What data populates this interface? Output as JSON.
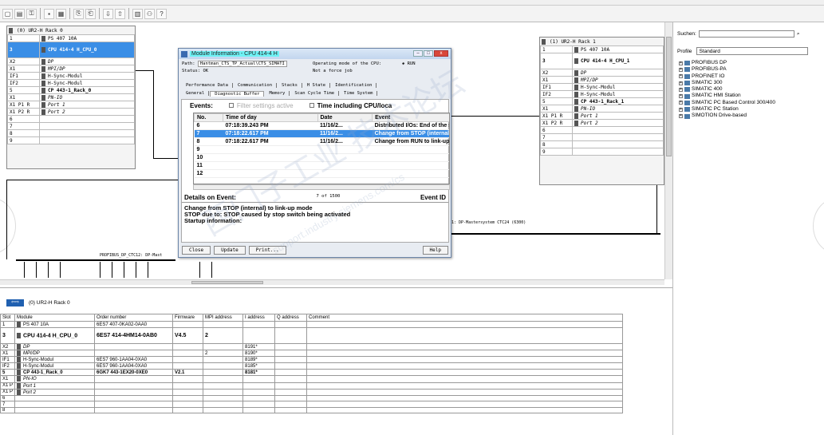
{
  "toolbar": {
    "icons": [
      "new-icon",
      "open-icon",
      "network-icon",
      "save-icon",
      "print-icon",
      "copy-icon",
      "paste-icon",
      "download-icon",
      "upload-icon",
      "catalog-icon",
      "net-icon",
      "help-icon"
    ]
  },
  "rack0": {
    "title": "(0) UR2-H Rack 0",
    "rows": [
      {
        "slot": "1",
        "module": "PS 407 10A",
        "big": false
      },
      {
        "slot": "3",
        "module": "CPU 414-4 H_CPU_0",
        "big": true,
        "selected": true
      },
      {
        "slot": "X2",
        "module": "DP",
        "italic": true
      },
      {
        "slot": "X1",
        "module": "MPI/DP",
        "italic": true
      },
      {
        "slot": "IF1",
        "module": "H-Sync-Modul"
      },
      {
        "slot": "IF2",
        "module": "H-Sync-Modul"
      },
      {
        "slot": "5",
        "module": "CP 443-1_Rack_0",
        "bold": true
      },
      {
        "slot": "X1",
        "module": "PN-IO",
        "italic": true
      },
      {
        "slot": "X1 P1 R",
        "module": "Port 1",
        "italic": true
      },
      {
        "slot": "X1 P2 R",
        "module": "Port 2",
        "italic": true
      },
      {
        "slot": "6",
        "module": ""
      },
      {
        "slot": "7",
        "module": ""
      },
      {
        "slot": "8",
        "module": ""
      },
      {
        "slot": "9",
        "module": ""
      }
    ]
  },
  "rack1": {
    "title": "(1) UR2-H Rack 1",
    "rows": [
      {
        "slot": "1",
        "module": "PS 407 10A",
        "big": false
      },
      {
        "slot": "3",
        "module": "CPU 414-4 H_CPU_1",
        "big": true
      },
      {
        "slot": "X2",
        "module": "DP",
        "italic": true
      },
      {
        "slot": "X1",
        "module": "MPI/DP",
        "italic": true
      },
      {
        "slot": "IF1",
        "module": "H-Sync-Modul"
      },
      {
        "slot": "IF2",
        "module": "H-Sync-Modul"
      },
      {
        "slot": "5",
        "module": "CP 443-1_Rack_1",
        "bold": true
      },
      {
        "slot": "X1",
        "module": "PN-IO",
        "italic": true
      },
      {
        "slot": "X1 P1 R",
        "module": "Port 1",
        "italic": true
      },
      {
        "slot": "X1 P2 R",
        "module": "Port 2",
        "italic": true
      },
      {
        "slot": "6",
        "module": ""
      },
      {
        "slot": "7",
        "module": ""
      },
      {
        "slot": "8",
        "module": ""
      },
      {
        "slot": "9",
        "module": ""
      }
    ]
  },
  "bus": {
    "profibus_label": "PROFIBUS_DP_CTC12: DP-Mast",
    "dp_label": "1: DP-Mastersystem CTC24 (6300)"
  },
  "dialog": {
    "title": "Module Information - CPU 414-4 H",
    "path_label": "Path:",
    "path_value": "Hantman_CTS_TP_Actual\\CTS_SIMATI",
    "mode_label": "Operating mode of the CPU:",
    "mode_value": "RUN",
    "status_label": "Status: OK",
    "force_text": "Not a force job",
    "tabs_row1": [
      "Performance Data",
      "Communication",
      "Stacks",
      "H State",
      "Identification"
    ],
    "tabs_row2": [
      "General",
      "Diagnostic Buffer",
      "Memory",
      "Scan Cycle Time",
      "Time System"
    ],
    "active_tab": "Diagnostic Buffer",
    "events_label": "Events:",
    "filter_label": "Filter settings active",
    "time_label": "Time including CPU/loca",
    "columns": [
      "No.",
      "Time of day",
      "Date",
      "Event"
    ],
    "events": [
      {
        "no": "6",
        "time": "07:18:39.243 PM",
        "date": "11/16/2...",
        "event": "Distributed I/Os: End of the synchronizi"
      },
      {
        "no": "7",
        "time": "07:18:22.617 PM",
        "date": "11/16/2...",
        "event": "Change from STOP (internal) to link-up r",
        "highlight": true
      },
      {
        "no": "8",
        "time": "07:18:22.617 PM",
        "date": "11/16/2...",
        "event": "Change from RUN to link-up mode"
      },
      {
        "no": "9",
        "time": "",
        "date": "",
        "event": ""
      },
      {
        "no": "10",
        "time": "",
        "date": "",
        "event": ""
      },
      {
        "no": "11",
        "time": "",
        "date": "",
        "event": ""
      },
      {
        "no": "12",
        "time": "",
        "date": "",
        "event": ""
      }
    ],
    "details_label": "Details on Event:",
    "details_count": "7 of 1500",
    "event_id_label": "Event ID",
    "details_lines": [
      "Change from STOP (internal) to link-up mode",
      "STOP due to: STOP caused by stop switch being activated",
      "Startup information:"
    ],
    "buttons": [
      "Close",
      "Update",
      "Print...",
      "Help"
    ]
  },
  "side": {
    "search_label": "Suchen:",
    "profile_label": "Profile",
    "profile_value": "Standard",
    "tree": [
      "PROFIBUS DP",
      "PROFIBUS-PA",
      "PROFINET IO",
      "SIMATIC 300",
      "SIMATIC 400",
      "SIMATIC HMI Station",
      "SIMATIC PC Based Control 300/400",
      "SIMATIC PC Station",
      "SIMOTION Drive-based"
    ]
  },
  "bottom": {
    "title": "(0) UR2-H Rack 0",
    "columns": [
      "Slot",
      "Module",
      "Order number",
      "Firmware",
      "MPI address",
      "I address",
      "Q address",
      "Comment"
    ],
    "rows": [
      {
        "slot": "1",
        "module": "PS 407 10A",
        "order": "6ES7 407-0KA02-0AA0",
        "fw": "",
        "mpi": "",
        "i": "",
        "q": "",
        "comment": ""
      },
      {
        "slot": "3",
        "module": "CPU 414-4 H_CPU_0",
        "order": "6ES7 414-4HM14-0AB0",
        "fw": "V4.5",
        "mpi": "2",
        "i": "",
        "q": "",
        "comment": "",
        "big": true
      },
      {
        "slot": "X2",
        "module": "DP",
        "order": "",
        "fw": "",
        "mpi": "",
        "i": "8191*",
        "q": "",
        "comment": "",
        "italic": true
      },
      {
        "slot": "X1",
        "module": "MPI/DP",
        "order": "",
        "fw": "",
        "mpi": "2",
        "i": "8190*",
        "q": "",
        "comment": "",
        "italic": true
      },
      {
        "slot": "IF1",
        "module": "H-Sync-Modul",
        "order": "6ES7 960-1AA04-0XA0",
        "fw": "",
        "mpi": "",
        "i": "8189*",
        "q": "",
        "comment": ""
      },
      {
        "slot": "IF2",
        "module": "H-Sync-Modul",
        "order": "6ES7 960-1AA04-0XA0",
        "fw": "",
        "mpi": "",
        "i": "8185*",
        "q": "",
        "comment": ""
      },
      {
        "slot": "5",
        "module": "CP 443-1_Rack_0",
        "order": "6GK7 443-1EX20-0XE0",
        "fw": "V2.1",
        "mpi": "",
        "i": "8181*",
        "q": "",
        "comment": "",
        "bold": true
      },
      {
        "slot": "X1",
        "module": "PN-IO",
        "order": "",
        "fw": "",
        "mpi": "",
        "i": "",
        "q": "",
        "comment": "",
        "italic": true
      },
      {
        "slot": "X1 P",
        "module": "Port 1",
        "order": "",
        "fw": "",
        "mpi": "",
        "i": "",
        "q": "",
        "comment": "",
        "italic": true
      },
      {
        "slot": "X1 P",
        "module": "Port 2",
        "order": "",
        "fw": "",
        "mpi": "",
        "i": "",
        "q": "",
        "comment": "",
        "italic": true
      },
      {
        "slot": "6",
        "module": "",
        "order": "",
        "fw": "",
        "mpi": "",
        "i": "",
        "q": "",
        "comment": ""
      },
      {
        "slot": "7",
        "module": "",
        "order": "",
        "fw": "",
        "mpi": "",
        "i": "",
        "q": "",
        "comment": ""
      },
      {
        "slot": "8",
        "module": "",
        "order": "",
        "fw": "",
        "mpi": "",
        "i": "",
        "q": "",
        "comment": ""
      }
    ]
  }
}
